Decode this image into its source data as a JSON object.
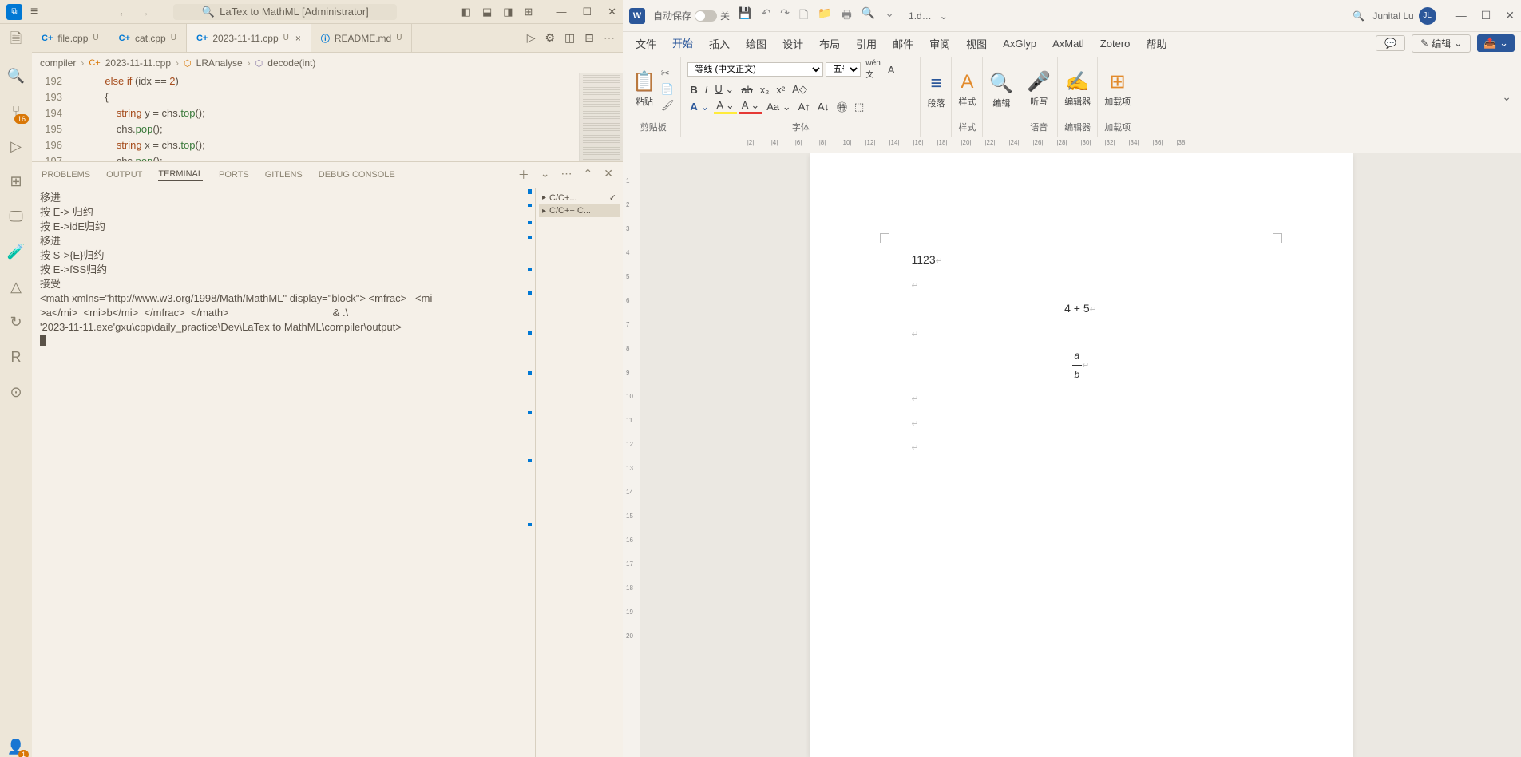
{
  "vscode": {
    "title": "LaTex to MathML [Administrator]",
    "tabs": [
      {
        "icon": "C+",
        "name": "file.cpp",
        "mod": "U",
        "active": false
      },
      {
        "icon": "C+",
        "name": "cat.cpp",
        "mod": "U",
        "active": false
      },
      {
        "icon": "C+",
        "name": "2023-11-11.cpp",
        "mod": "U",
        "active": true,
        "close": true
      },
      {
        "icon": "ⓘ",
        "name": "README.md",
        "mod": "U",
        "active": false
      }
    ],
    "breadcrumb": {
      "root": "compiler",
      "file": "2023-11-11.cpp",
      "class": "LRAnalyse",
      "method": "decode(int)"
    },
    "code_lines": [
      {
        "no": "192",
        "text": "            else if (idx == 2)"
      },
      {
        "no": "193",
        "text": "            {"
      },
      {
        "no": "194",
        "text": "                string y = chs.top();"
      },
      {
        "no": "195",
        "text": "                chs.pop();"
      },
      {
        "no": "196",
        "text": "                string x = chs.top();"
      },
      {
        "no": "197",
        "text": "                chs.pop();"
      }
    ],
    "activity_badge": "16",
    "account_badge": "1",
    "panel_tabs": [
      "PROBLEMS",
      "OUTPUT",
      "TERMINAL",
      "PORTS",
      "GITLENS",
      "DEBUG CONSOLE"
    ],
    "panel_active": "TERMINAL",
    "terminal_text": "移进\n按 E-> 归约\n按 E->idE归约\n移进\n按 S->{E}归约\n按 E->fSS归约\n接受\n<math xmlns=\"http://www.w3.org/1998/Math/MathML\" display=\"block\"> <mfrac>   <mi\n>a</mi>  <mi>b</mi>  </mfrac>  </math>                                    & .\\\n'2023-11-11.exe'gxu\\cpp\\daily_practice\\Dev\\LaTex to MathML\\compiler\\output>",
    "terminal_side": [
      {
        "label": "C/C+...",
        "active": false,
        "check": true
      },
      {
        "label": "C/C++ C...",
        "active": true
      }
    ]
  },
  "word": {
    "autosave_label": "自动保存",
    "autosave_state": "关",
    "docname": "1.d…",
    "username": "Junital Lu",
    "avatar": "JL",
    "ribbon_tabs": [
      "文件",
      "开始",
      "插入",
      "绘图",
      "设计",
      "布局",
      "引用",
      "邮件",
      "审阅",
      "视图",
      "AxGlyp",
      "AxMatl",
      "Zotero",
      "帮助"
    ],
    "ribbon_active": "开始",
    "comment_btn": "💬",
    "edit_btn": "编辑",
    "groups": {
      "clipboard": {
        "label": "剪贴板",
        "paste": "粘贴"
      },
      "font": {
        "label": "字体",
        "name": "等线 (中文正文)",
        "size": "五号"
      },
      "paragraph": {
        "label": "段落"
      },
      "styles": {
        "label": "样式",
        "btn": "样式"
      },
      "edit": {
        "label": "编辑"
      },
      "dictate": {
        "label": "语音",
        "btn": "听写"
      },
      "editor": {
        "label": "编辑器",
        "btn": "编辑器"
      },
      "addins": {
        "label": "加载项",
        "btn": "加载项"
      }
    },
    "doc": {
      "line1": "1123",
      "line3": "4 + 5",
      "frac_num": "a",
      "frac_den": "b"
    }
  }
}
